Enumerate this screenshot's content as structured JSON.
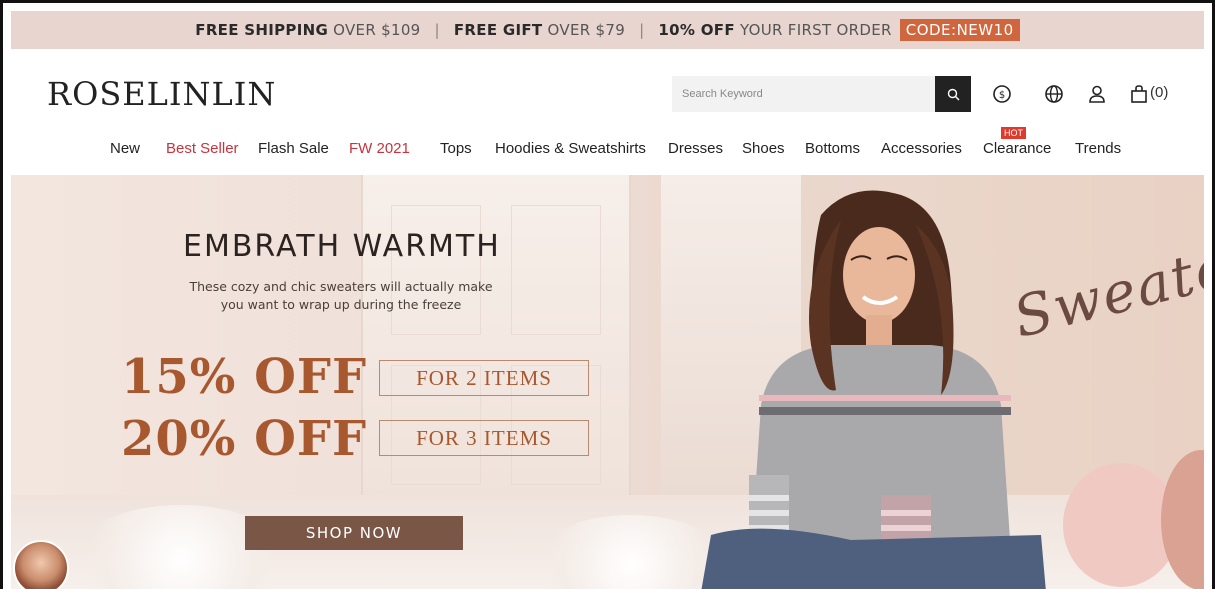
{
  "promo": {
    "shipping_bold": "FREE SHIPPING",
    "shipping_rest": "OVER $109",
    "gift_bold": "FREE GIFT",
    "gift_rest": "OVER $79",
    "discount_bold": "10% OFF",
    "discount_rest": "YOUR FIRST ORDER",
    "code": "CODE:NEW10",
    "separator": "|"
  },
  "header": {
    "logo": "ROSELINLIN",
    "search_placeholder": "Search Keyword",
    "cart_count": "(0)",
    "icons": [
      "search-icon",
      "currency-icon",
      "globe-icon",
      "user-icon",
      "bag-icon"
    ]
  },
  "nav": {
    "items": [
      {
        "label": "New",
        "highlight": false
      },
      {
        "label": "Best Seller",
        "highlight": true
      },
      {
        "label": "Flash Sale",
        "highlight": false
      },
      {
        "label": "FW 2021",
        "highlight": true
      },
      {
        "label": "Tops",
        "highlight": false
      },
      {
        "label": "Hoodies & Sweatshirts",
        "highlight": false
      },
      {
        "label": "Dresses",
        "highlight": false
      },
      {
        "label": "Shoes",
        "highlight": false
      },
      {
        "label": "Bottoms",
        "highlight": false
      },
      {
        "label": "Accessories",
        "highlight": false
      },
      {
        "label": "Clearance",
        "highlight": false
      },
      {
        "label": "Trends",
        "highlight": false
      }
    ],
    "hot_badge": "HOT"
  },
  "hero": {
    "title": "EMBRATH WARMTH",
    "subtitle_line1": "These cozy and chic sweaters will actually make",
    "subtitle_line2": "you want to wrap up during the freeze",
    "offer1_percent": "15% OFF",
    "offer1_items": "FOR 2 ITEMS",
    "offer2_percent": "20% OFF",
    "offer2_items": "FOR 3 ITEMS",
    "cta": "SHOP NOW",
    "script_word": "Sweaters"
  },
  "colors": {
    "promo_bg": "#e8d5cf",
    "code_bg": "#d0663d",
    "highlight_red": "#c8333e",
    "offer_brown": "#a8582f",
    "cta_bg": "#7a5647",
    "hot_badge": "#e03a2c"
  }
}
